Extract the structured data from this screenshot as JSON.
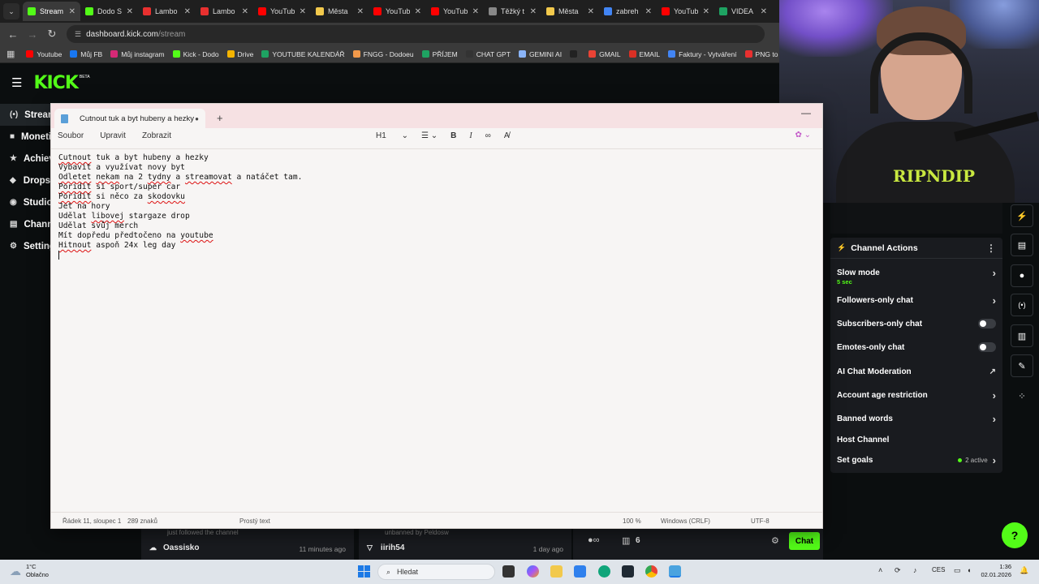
{
  "browser": {
    "tabs": [
      {
        "label": "Stream",
        "color": "#53fc18",
        "active": true
      },
      {
        "label": "Dodo S",
        "color": "#53fc18",
        "active": false
      },
      {
        "label": "Lambo",
        "color": "#e8302f",
        "active": false
      },
      {
        "label": "Lambo",
        "color": "#e8302f",
        "active": false
      },
      {
        "label": "YouTub",
        "color": "#ff0000",
        "active": false
      },
      {
        "label": "Města",
        "color": "#f2c94c",
        "active": false
      },
      {
        "label": "YouTub",
        "color": "#ff0000",
        "active": false
      },
      {
        "label": "YouTub",
        "color": "#ff0000",
        "active": false
      },
      {
        "label": "Těžký t",
        "color": "#888888",
        "active": false
      },
      {
        "label": "Města",
        "color": "#f2c94c",
        "active": false
      },
      {
        "label": "zabreh",
        "color": "#4285f4",
        "active": false
      },
      {
        "label": "YouTub",
        "color": "#ff0000",
        "active": false
      },
      {
        "label": "VIDEA",
        "color": "#1ea362",
        "active": false
      }
    ],
    "url_host": "dashboard.kick.com",
    "url_path": "/stream",
    "bookmarks": [
      {
        "label": "Youtube",
        "color": "#ff0000"
      },
      {
        "label": "Můj FB",
        "color": "#1877f2"
      },
      {
        "label": "Můj instagram",
        "color": "#d62976"
      },
      {
        "label": "Kick - Dodo",
        "color": "#53fc18"
      },
      {
        "label": "Drive",
        "color": "#f4b400"
      },
      {
        "label": "YOUTUBE KALENDÁŘ",
        "color": "#1ea362"
      },
      {
        "label": "FNGG - Dodoeu",
        "color": "#f2994a"
      },
      {
        "label": "PŘÍJEM",
        "color": "#1ea362"
      },
      {
        "label": "CHAT GPT",
        "color": "#333333"
      },
      {
        "label": "GEMINI AI",
        "color": "#8ab4f8"
      },
      {
        "label": "",
        "color": "#222222"
      },
      {
        "label": "GMAIL",
        "color": "#ea4335"
      },
      {
        "label": "EMAIL",
        "color": "#d93025"
      },
      {
        "label": "Faktury - Vytváření",
        "color": "#4285f4"
      },
      {
        "label": "PNG to PDF",
        "color": "#e8302f"
      }
    ]
  },
  "kick": {
    "logo": "KICK",
    "beta": "BETA",
    "nav": [
      {
        "label": "Stream",
        "icon": "(•)",
        "active": true
      },
      {
        "label": "Monetization",
        "icon": "■",
        "active": false
      },
      {
        "label": "Achievements",
        "icon": "★",
        "active": false
      },
      {
        "label": "Drops",
        "icon": "◆",
        "active": false
      },
      {
        "label": "Studio",
        "icon": "◉",
        "active": false
      },
      {
        "label": "Channel",
        "icon": "▤",
        "active": false
      },
      {
        "label": "Settings",
        "icon": "⚙",
        "active": false
      }
    ],
    "bottom": {
      "left_sub": "just followed the channel",
      "left_name": "Oassisko",
      "left_time": "11 minutes ago",
      "mid_sub": "unbanned by Peldosw",
      "mid_name": "iirih54",
      "mid_time": "1 day ago",
      "right_count": "6",
      "chat_label": "Chat"
    },
    "channel_actions": {
      "title": "Channel Actions",
      "slow_mode": "Slow mode",
      "slow_mode_value": "5 sec",
      "followers_only": "Followers-only chat",
      "subscribers_only": "Subscribers-only chat",
      "emotes_only": "Emotes-only chat",
      "ai_moderation": "AI Chat Moderation",
      "age_restriction": "Account age restriction",
      "banned_words": "Banned words",
      "host_channel": "Host Channel",
      "set_goals": "Set goals",
      "goals_active": "2 active"
    }
  },
  "webcam": {
    "shirt_text": "RIPNDIP"
  },
  "notepad": {
    "tab_title": "Cutnout tuk a byt hubeny a hezky",
    "menu": [
      "Soubor",
      "Upravit",
      "Zobrazit"
    ],
    "heading_tool": "H1",
    "lines": [
      "Cutnout tuk a byt hubeny a hezky",
      "Vybavit a využívat novy byt",
      "Odletet nekam na 2 tydny a streamovat a natáčet tam.",
      "Poridit si sport/super car",
      "Poridit si něco za skodovku",
      "Jet na hory",
      "Udělat libovej stargaze drop",
      "Udělat svůj merch",
      "Mít dopředu předtočeno na youtube",
      "Hitnout aspoň 24x leg day"
    ],
    "status": {
      "position": "Řádek 11, sloupec 1",
      "chars": "289 znaků",
      "format": "Prostý text",
      "zoom": "100 %",
      "eol": "Windows (CRLF)",
      "encoding": "UTF-8"
    }
  },
  "taskbar": {
    "temp": "1°C",
    "weather": "Oblačno",
    "search_placeholder": "Hledat",
    "lang": "CES",
    "time": "1:36",
    "date": "02.01.2026"
  }
}
